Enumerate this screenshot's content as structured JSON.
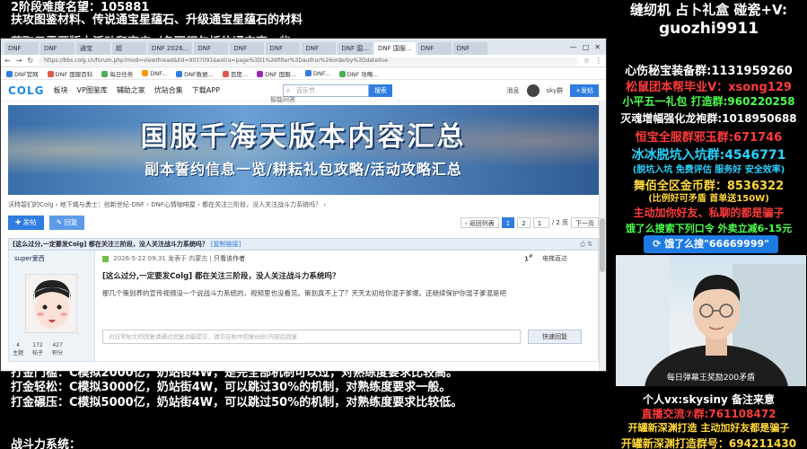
{
  "overlay_top": {
    "line1": "2阶段难度名望：105881",
    "line2": "扶攻图鉴材料、传说通宝星蕴石、升级通宝星蕴石的材料",
    "line3": "获取只需要版本活动和商店（各职都包括的通宝声一些"
  },
  "browser": {
    "tabs": [
      "DNF",
      "DNF",
      "通宝",
      "超",
      "DNF 2026...",
      "DNF",
      "DNF",
      "DNF",
      "DNF",
      "DNF 国...",
      "DNF 国服...",
      "DNF",
      "DNF"
    ],
    "window_controls": [
      "—",
      "□",
      "✕"
    ],
    "url": "https://bbs.colg.cn/forum.php?mod=viewthread&tid=9037091&extra=page%3D1%26filter%3Dauthor%26orderby%3Ddateline",
    "bookmarks": [
      "DNF官网",
      "DNF 国服百科",
      "每日任务",
      "DNF...",
      "...",
      "DNF数据...",
      "...",
      "...",
      "...",
      "百度...",
      "DNF 国服...",
      "DNF...",
      "...",
      "...",
      "...",
      "DNF 攻略..."
    ],
    "site": {
      "logo": "COLG",
      "nav": [
        "板块",
        "VP图鉴库",
        "辅助之家",
        "优站合集",
        "下载APP"
      ],
      "search_placeholder": "百乐节",
      "search_button": "搜索",
      "sub_label": "智能问答",
      "messages": "消息",
      "username": "sky群",
      "post_button": "+发帖"
    },
    "banner": {
      "title": "国服千海天版本内容汇总",
      "subtitle": "副本誓约信息一览/耕耘礼包攻略/活动攻略汇总"
    },
    "breadcrumb": "沃特碧们的Colg  ›  地下城与勇士：创新世纪-DNF  ›  DNF心情咖啡屋  ›  都在关注三阶段，没人关注战斗力系统吗？  ›",
    "toolbar": {
      "post_label": "发帖",
      "reply_label": "回复",
      "back_label": "返回列表",
      "page_current": "1",
      "page_next": "2",
      "page_input": "1",
      "page_total": "/ 2 页",
      "next_label": "下一页"
    },
    "thread": {
      "title": "[这么过分,一定要发Colg] 都在关注三阶段，没人关注战斗力系统吗？",
      "copy_link": "[复制链接]",
      "author": "super爱西",
      "meta": "2026-5-22 09:31 发表于 内蒙古",
      "author_only": "只看该作者",
      "floor": "1",
      "floor_label": "电梯直达",
      "post_title": "[这么过分,一定要发Colg] 都在关注三阶段，没人关注战斗力系统吗？",
      "post_text": "那几个策划养的宣传视频没一个说战斗力系统的，视频里也没看见。策划真不上了？天天太初给你混子爹爆。还继续保护你混子爹混是吧",
      "reply_placeholder": "对日常帖文的回复请通过回复功能提交，请勿在帖中回复纠纷/内容后回复",
      "reply_button": "快速回复",
      "stats": [
        {
          "value": "4",
          "label": "主题"
        },
        {
          "value": "172",
          "label": "帖子"
        },
        {
          "value": "427",
          "label": "积分"
        }
      ]
    }
  },
  "overlay_bottom": {
    "line1": "打金门槛：C模拟2000亿，奶站街4W，是完全部机制可以过，对熟练度要求比较高。",
    "line2": "打金轻松：C模拟3000亿，奶站街4W，可以跳过30%的机制，对熟练度要求一般。",
    "line3": "打金碾压：C模拟5000亿，奶站街4W，可以跳过50%的机制，对熟练度要求比较低。",
    "line4": "战斗力系统："
  },
  "right_panel": {
    "line1": "缝纫机 占卜礼盒 碰瓷+V:",
    "line2": "guozhi9911",
    "line3": "心伤秘宝装备群:1131959260",
    "line4": "松鼠团本帮毕业V：xsong129",
    "line5": "小平五一礼包 打造群:960220258",
    "line6": "灭魂增幅强化龙袍群:1018950688",
    "line7": "恒宝全服群邪玉群:671746",
    "line8": "冰冰脱坑入坑群:4546771",
    "line9": "(脱坑入坑 免费评估 服务好 安全效率)",
    "line10": "舞佰全区金币群：8536322",
    "line11": "(比例好可矛盾 首单送150W)",
    "line12": "主动加你好友、私聊的都是骗子",
    "line13": "饿了么搜索下列口令 外卖立减6-15元",
    "search_pill": "饿了么搜\"66669999\"",
    "cam_caption": "每日弹幕王奖励200矛盾",
    "line14": "个人vx:skysiny 备注来意",
    "line15": "直播交流⑦群:761108472",
    "line16": "开罐新深渊打造 主动加好友都是骗子",
    "line17": "开罐新深渊打造群号：694211430"
  }
}
